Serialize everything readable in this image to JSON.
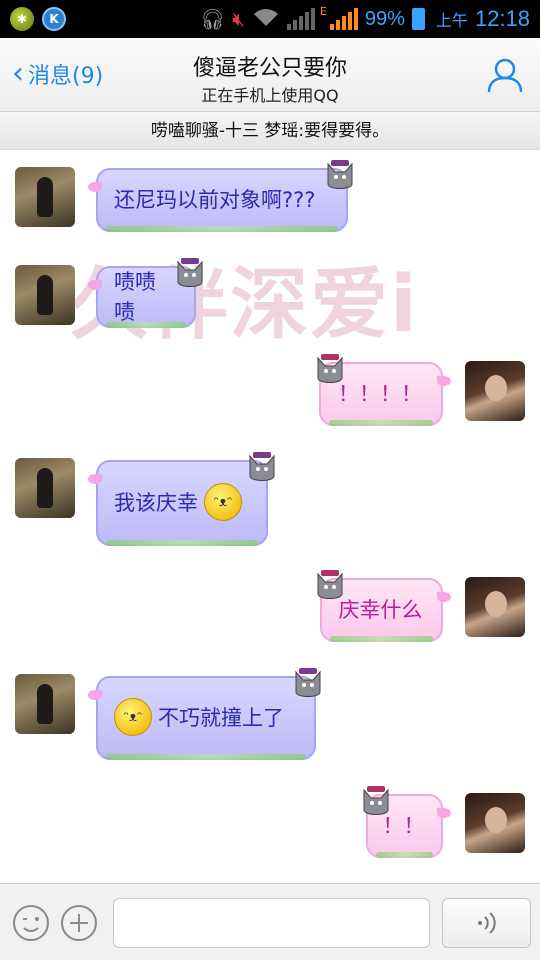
{
  "status_bar": {
    "battery_pct": "99%",
    "ampm": "上午",
    "time": "12:18",
    "network_letter": "E"
  },
  "header": {
    "back_label": "消息(9)",
    "title": "傻逼老公只要你",
    "subtitle": "正在手机上使用QQ"
  },
  "notice": {
    "text": "唠嗑聊骚-十三   梦瑶:要得要得。"
  },
  "watermark": "久伴深爱i",
  "messages": [
    {
      "side": "left",
      "text": "还尼玛以前对象啊???",
      "emoji": ""
    },
    {
      "side": "left",
      "text": "啧啧啧",
      "emoji": ""
    },
    {
      "side": "right",
      "text": "！！！！",
      "emoji": ""
    },
    {
      "side": "left",
      "text": "我该庆幸",
      "emoji": "smiley-after"
    },
    {
      "side": "right",
      "text": "庆幸什么",
      "emoji": ""
    },
    {
      "side": "left",
      "text": "不巧就撞上了",
      "emoji": "smiley-before"
    },
    {
      "side": "right",
      "text": "！！",
      "emoji": ""
    }
  ],
  "input": {
    "value": "",
    "placeholder": ""
  },
  "colors": {
    "accent_blue": "#1a8ae6",
    "friend_bubble": "#c9c6fa",
    "my_bubble": "#fcd3ef"
  }
}
